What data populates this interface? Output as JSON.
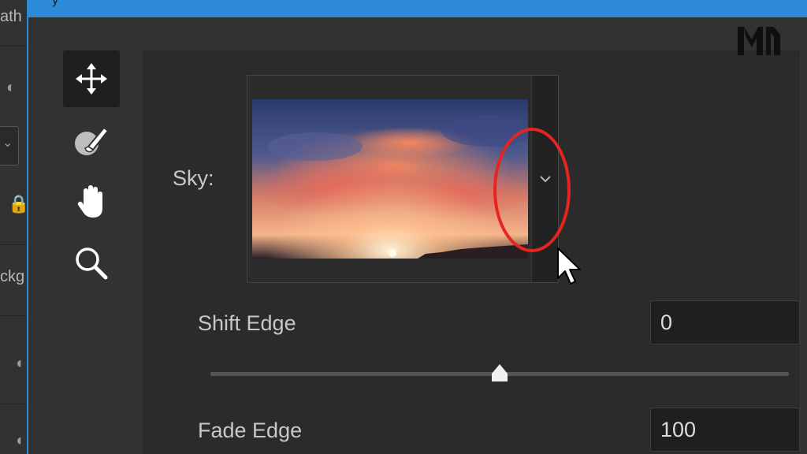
{
  "background_app": {
    "fragment_top": "ath",
    "fragment_mid": "ckg"
  },
  "dialog": {
    "title_fragment": "y",
    "tools": [
      {
        "name": "move-tool",
        "icon": "move-arrows-icon",
        "active": true
      },
      {
        "name": "sky-brush-tool",
        "icon": "sky-brush-icon",
        "active": false
      },
      {
        "name": "hand-tool",
        "icon": "hand-icon",
        "active": false
      },
      {
        "name": "zoom-tool",
        "icon": "zoom-icon",
        "active": false
      }
    ],
    "sky": {
      "label": "Sky:",
      "dropdown_icon": "chevron-down-icon"
    },
    "shift_edge": {
      "label": "Shift Edge",
      "value": "0",
      "slider_fraction": 0.5
    },
    "fade_edge": {
      "label": "Fade Edge",
      "value": "100"
    }
  },
  "annotation": {
    "shape": "ellipse",
    "color": "#e52521"
  },
  "watermark": {
    "icon": "logo-watermark-icon"
  },
  "colors": {
    "titlebar": "#2d8ad6",
    "panel_bg": "#2b2b2b",
    "dialog_bg": "#323232",
    "field_bg": "#1f1f1f",
    "text": "#c8c8c8"
  }
}
